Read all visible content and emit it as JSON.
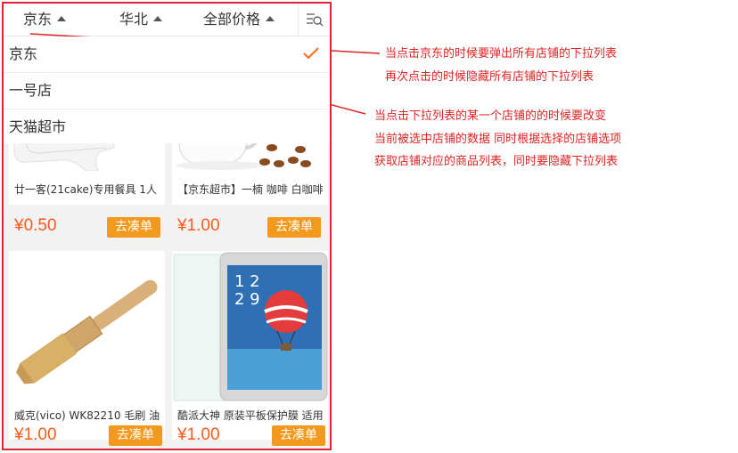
{
  "filters": {
    "store": "京东",
    "region": "华北",
    "price": "全部价格",
    "filter_icon": "filter-search-icon"
  },
  "dropdown": {
    "items": [
      {
        "label": "京东",
        "selected": true
      },
      {
        "label": "一号店",
        "selected": false
      },
      {
        "label": "天猫超市",
        "selected": false
      }
    ],
    "check_icon": "checkmark-icon"
  },
  "products": [
    {
      "name": "廿一客(21cake)专用餐具 1人",
      "price": "¥0.50",
      "button": "去凑单"
    },
    {
      "name": "【京东超市】一楠 咖啡 白咖啡",
      "price": "¥1.00",
      "button": "去凑单"
    },
    {
      "name": "威克(vico) WK82210 毛刷 油",
      "price": "¥1.00",
      "button": "去凑单"
    },
    {
      "name": "酷派大神 原装平板保护膜 适用",
      "price": "¥1.00",
      "button": "去凑单"
    }
  ],
  "phone_screen": {
    "time": "12 29"
  },
  "annotations": [
    "当点击京东的时候要弹出所有店铺的下拉列表",
    "再次点击的时候隐藏所有店铺的下拉列表",
    "当点击下拉列表的某一个店铺的的时候要改变",
    "当前被选中店铺的数据 同时根据选择的店铺选项",
    "获取店铺对应的商品列表，同时要隐藏下拉列表"
  ],
  "colors": {
    "frame": "#e0242f",
    "price": "#ff5a1a",
    "button": "#f39a1e",
    "check": "#ff6a1a",
    "annotation": "#e02424"
  }
}
